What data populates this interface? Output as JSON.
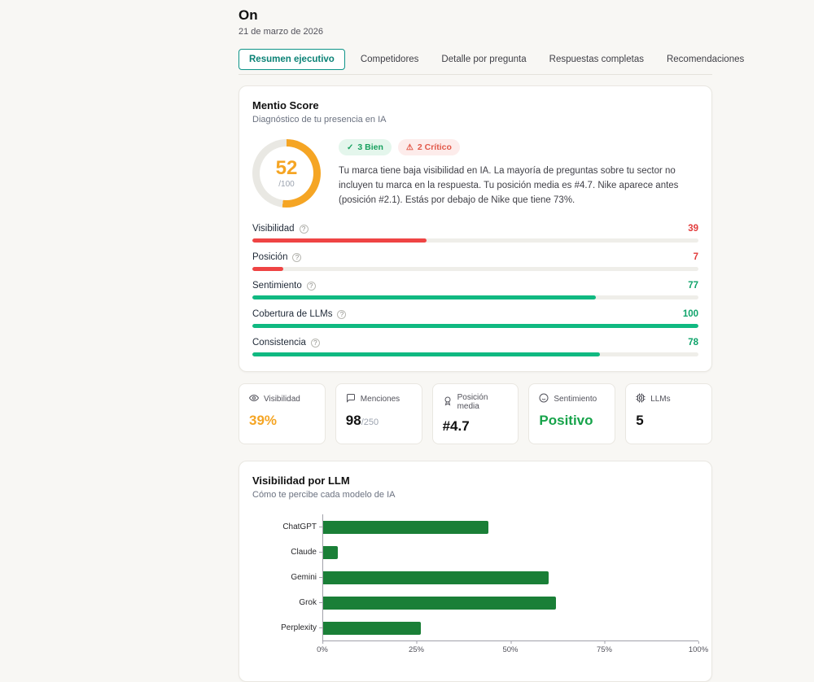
{
  "header": {
    "title": "On",
    "date": "21 de marzo de 2026"
  },
  "tabs": [
    {
      "label": "Resumen ejecutivo",
      "active": true
    },
    {
      "label": "Competidores",
      "active": false
    },
    {
      "label": "Detalle por pregunta",
      "active": false
    },
    {
      "label": "Respuestas completas",
      "active": false
    },
    {
      "label": "Recomendaciones",
      "active": false
    }
  ],
  "score_card": {
    "title": "Mentio Score",
    "subtitle": "Diagnóstico de tu presencia en IA",
    "badges": [
      {
        "label": "3 Bien",
        "type": "good",
        "icon": "check-circle-icon"
      },
      {
        "label": "2 Crítico",
        "type": "critical",
        "icon": "alert-icon"
      }
    ],
    "gauge": {
      "value": 52,
      "max_label": "/100"
    },
    "description": "Tu marca tiene baja visibilidad en IA. La mayoría de preguntas sobre tu sector no incluyen tu marca en la respuesta. Tu posición media es #4.7. Nike aparece antes (posición #2.1). Estás por debajo de Nike que tiene 73%.",
    "metrics": [
      {
        "label": "Visibilidad",
        "value": 39,
        "status": "red"
      },
      {
        "label": "Posición",
        "value": 7,
        "status": "red"
      },
      {
        "label": "Sentimiento",
        "value": 77,
        "status": "green"
      },
      {
        "label": "Cobertura de LLMs",
        "value": 100,
        "status": "green"
      },
      {
        "label": "Consistencia",
        "value": 78,
        "status": "green"
      }
    ]
  },
  "stat_cards": [
    {
      "label": "Visibilidad",
      "icon": "eye-icon",
      "value": "39%",
      "color": "orange"
    },
    {
      "label": "Menciones",
      "icon": "comment-icon",
      "value": "98",
      "suffix": "/250",
      "color": "default"
    },
    {
      "label": "Posición media",
      "icon": "medal-icon",
      "value": "#4.7",
      "color": "default"
    },
    {
      "label": "Sentimiento",
      "icon": "smile-icon",
      "value": "Positivo",
      "color": "green"
    },
    {
      "label": "LLMs",
      "icon": "chip-icon",
      "value": "5",
      "color": "default"
    }
  ],
  "chart_card": {
    "title": "Visibilidad por LLM",
    "subtitle": "Cómo te percibe cada modelo de IA"
  },
  "chart_data": {
    "type": "bar",
    "orientation": "horizontal",
    "title": "Visibilidad por LLM",
    "categories": [
      "ChatGPT",
      "Claude",
      "Gemini",
      "Grok",
      "Perplexity"
    ],
    "values": [
      44,
      4,
      60,
      62,
      26
    ],
    "xlim": [
      0,
      100
    ],
    "xticks": [
      "0%",
      "25%",
      "50%",
      "75%",
      "100%"
    ],
    "bar_color": "#1a7f37",
    "grid": false,
    "legend": false
  },
  "colors": {
    "accent_teal": "#0d9488",
    "orange": "#f5a524",
    "red": "#ef4444",
    "green": "#10b981",
    "chart_green": "#1a7f37",
    "gauge_track": "#e9e8e3"
  }
}
